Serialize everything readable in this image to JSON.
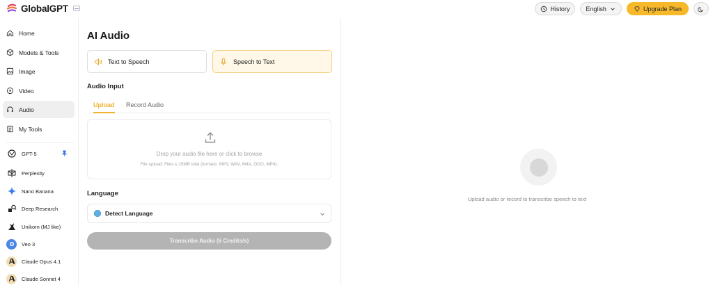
{
  "app": {
    "name": "GlobalGPT"
  },
  "header": {
    "history_label": "History",
    "language_label": "English",
    "upgrade_label": "Upgrade Plan"
  },
  "sidebar": {
    "nav": [
      {
        "label": "Home",
        "icon": "home-icon"
      },
      {
        "label": "Models & Tools",
        "icon": "cube-icon"
      },
      {
        "label": "Image",
        "icon": "image-icon"
      },
      {
        "label": "Video",
        "icon": "play-icon"
      },
      {
        "label": "Audio",
        "icon": "headphones-icon",
        "active": true
      },
      {
        "label": "My Tools",
        "icon": "document-icon"
      }
    ],
    "models": [
      {
        "label": "GPT-5",
        "icon": "openai-icon",
        "pinned": true
      },
      {
        "label": "Perplexity",
        "icon": "perplexity-icon"
      },
      {
        "label": "Nano Banana",
        "icon": "sparkle-icon"
      },
      {
        "label": "Deep Research",
        "icon": "research-icon"
      },
      {
        "label": "Unikorn (MJ like)",
        "icon": "unicorn-icon"
      },
      {
        "label": "Veo 3",
        "icon": "veo-icon"
      },
      {
        "label": "Claude Opus 4.1",
        "icon": "anthropic-icon"
      },
      {
        "label": "Claude Sonnet 4",
        "icon": "anthropic-icon"
      }
    ]
  },
  "main": {
    "title": "AI Audio",
    "modes": [
      {
        "label": "Text to Speech",
        "active": false
      },
      {
        "label": "Speech to Text",
        "active": true
      }
    ],
    "audio_input_label": "Audio Input",
    "tabs": [
      {
        "label": "Upload",
        "active": true
      },
      {
        "label": "Record Audio",
        "active": false
      }
    ],
    "dropzone": {
      "primary": "Drop your audio file here or click to browse",
      "secondary": "File upload: Files ≤ 15MB total (formats: MP3, WAV, M4A, OGG, MP4)."
    },
    "language_label": "Language",
    "language_value": "Detect Language",
    "transcribe_label": "Transcribe Audio (6 Credits/s)"
  },
  "right": {
    "message": "Upload audio or record to transcribe speech to text"
  },
  "colors": {
    "accent": "#f0b32f",
    "upgrade_bg": "#f7b82a",
    "disabled_button": "#b4b4b4"
  }
}
